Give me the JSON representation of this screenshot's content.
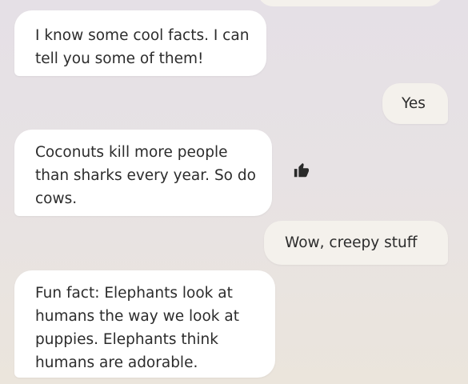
{
  "chat": {
    "messages": [
      {
        "role": "bot",
        "text": "I know some cool facts. I can tell you some of them!"
      },
      {
        "role": "user",
        "text": "Yes"
      },
      {
        "role": "bot",
        "text": "Coconuts kill more people than sharks every year. So do cows."
      },
      {
        "role": "user",
        "text": "Wow, creepy stuff"
      },
      {
        "role": "bot",
        "text": "Fun fact: Elephants look at humans the way we look at puppies. Elephants think humans are adorable."
      }
    ],
    "reaction_icon": "thumbs-up-icon"
  },
  "colors": {
    "bot_bubble": "#ffffff",
    "user_bubble": "#f4f1ec",
    "text": "#2c2c2c"
  }
}
